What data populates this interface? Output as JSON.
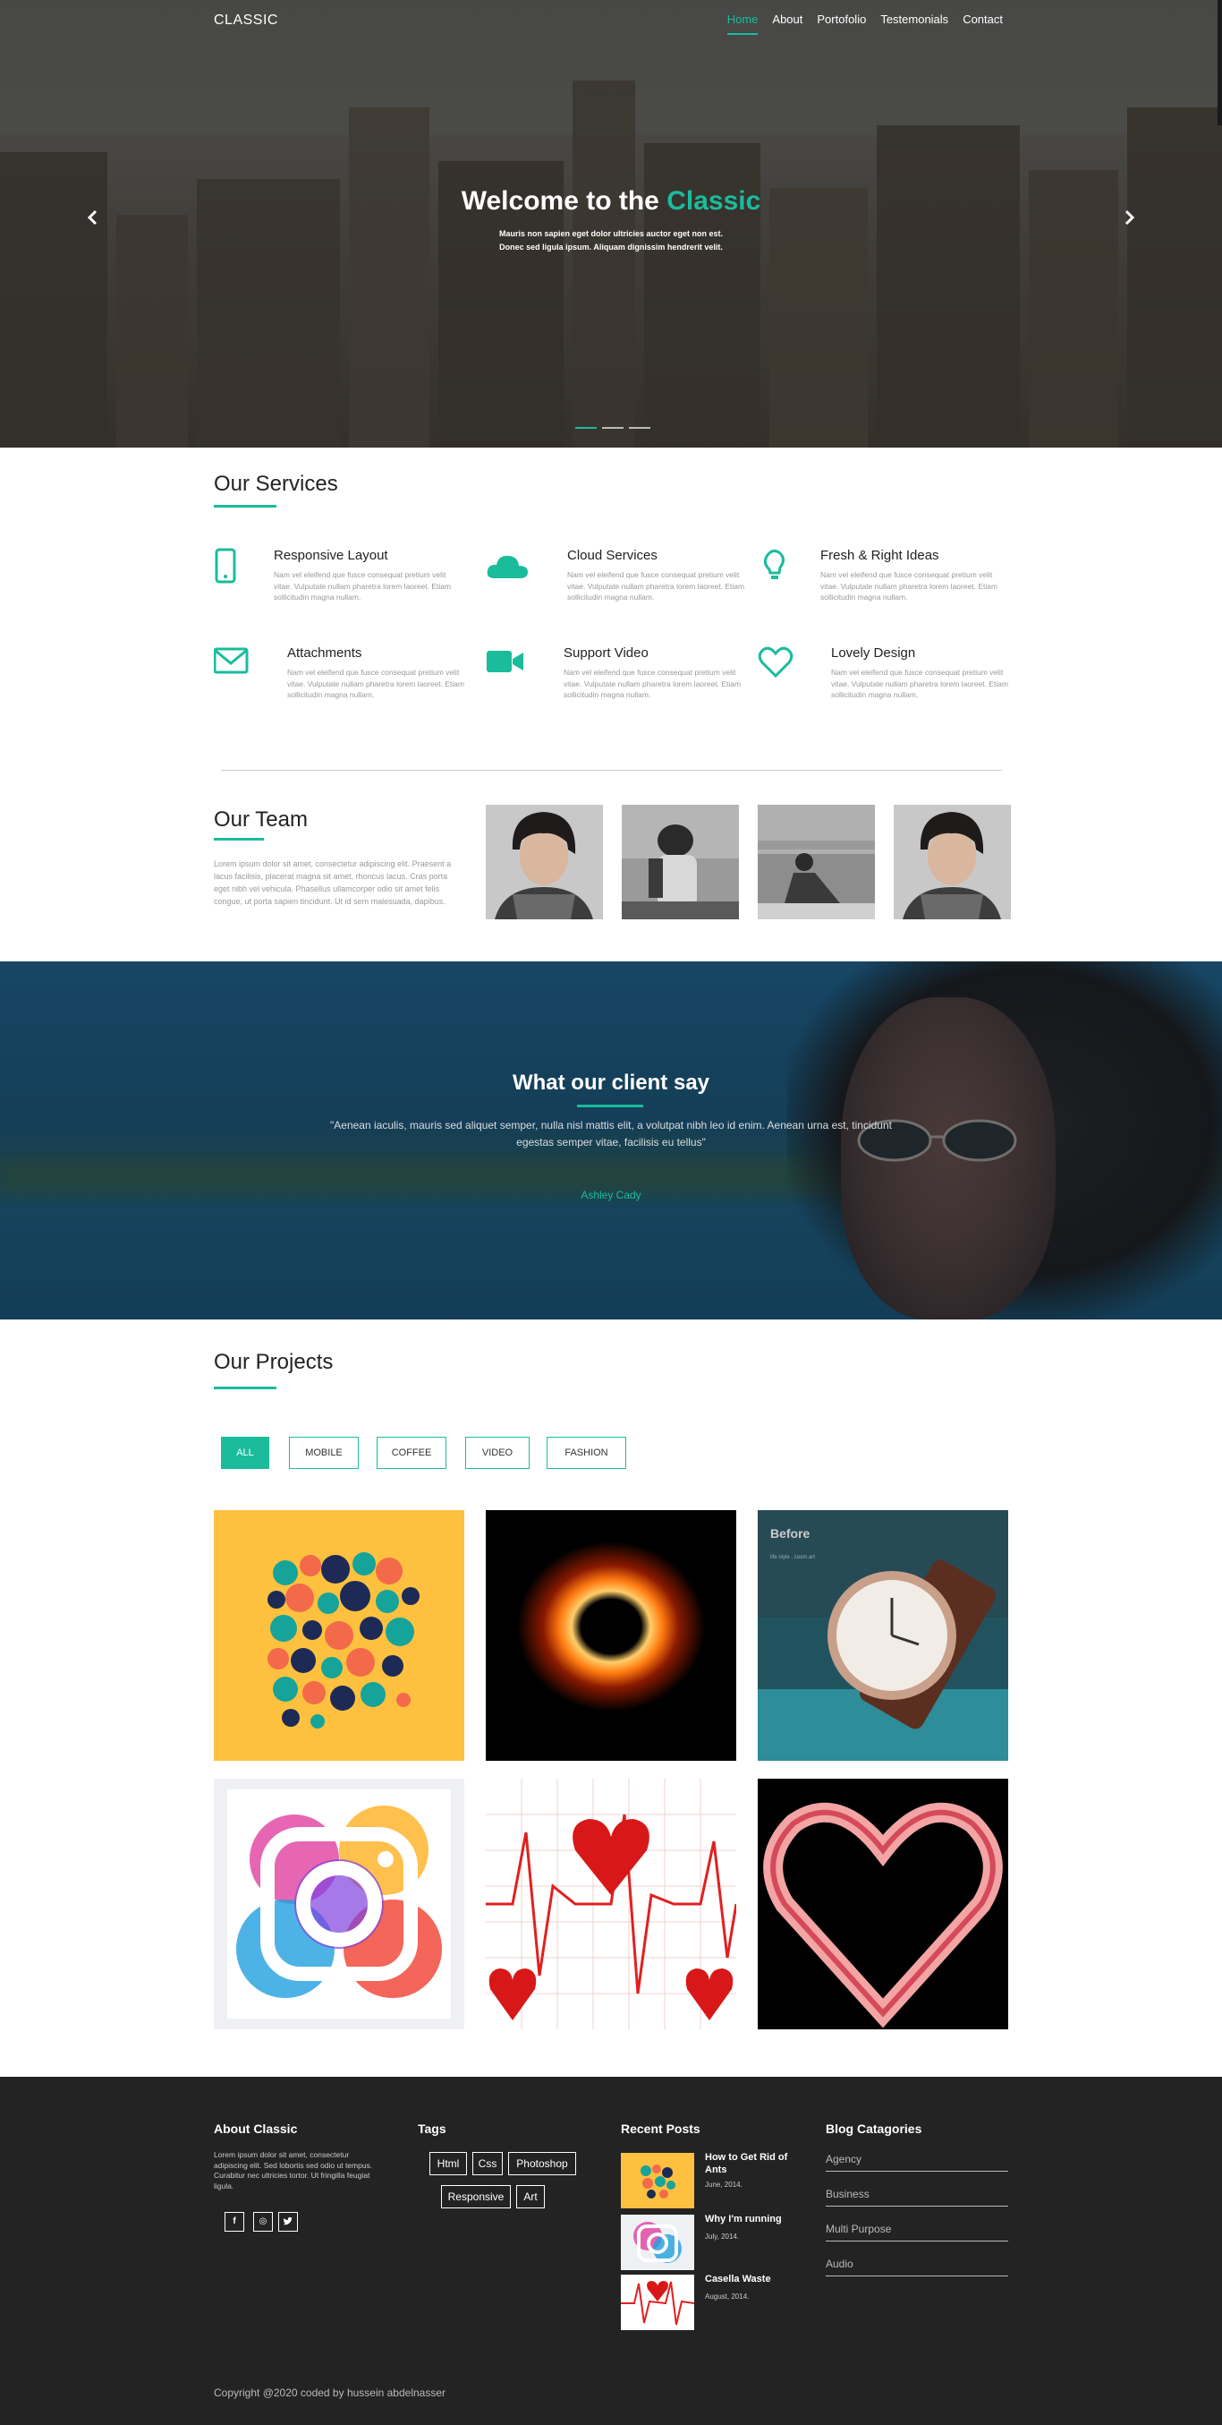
{
  "nav": {
    "logo": "CLASSIC",
    "items": [
      {
        "label": "Home",
        "active": true
      },
      {
        "label": "About"
      },
      {
        "label": "Portofolio"
      },
      {
        "label": "Testemonials"
      },
      {
        "label": "Contact"
      }
    ]
  },
  "hero": {
    "title_prefix": "Welcome to the ",
    "title_accent": "Classic",
    "subtitle_line1": "Mauris non sapien eget dolor ultricies auctor eget non est.",
    "subtitle_line2": "Donec sed ligula ipsum. Aliquam dignissim hendrerit velit.",
    "prev_icon": "chevron-left-icon",
    "next_icon": "chevron-right-icon",
    "slide_indicators": 3,
    "active_slide": 1
  },
  "services": {
    "heading": "Our Services",
    "items": [
      {
        "icon": "phone-icon",
        "title": "Responsive Layout",
        "text": "Nam vel eleifend que fusce consequat pretium velit vitae. Vulputate nullam pharetra lorem laoreet. Etiam sollicitudin magna nullam."
      },
      {
        "icon": "cloud-icon",
        "title": "Cloud Services",
        "text": "Nam vel eleifend que fusce consequat pretium velit vitae. Vulputate nullam pharetra lorem laoreet. Etiam sollicitudin magna nullam."
      },
      {
        "icon": "lightbulb-icon",
        "title": "Fresh & Right Ideas",
        "text": "Nam vel eleifend que fusce consequat pretium velit vitae. Vulputate nullam pharetra lorem laoreet. Etiam sollicitudin magna nullam."
      },
      {
        "icon": "envelope-icon",
        "title": "Attachments",
        "text": "Nam vel eleifend que fusce consequat pretium velit vitae. Vulputate nullam pharetra lorem laoreet. Etiam sollicitudin magna nullam."
      },
      {
        "icon": "video-camera-icon",
        "title": "Support Video",
        "text": "Nam vel eleifend que fusce consequat pretium velit vitae. Vulputate nullam pharetra lorem laoreet. Etiam sollicitudin magna nullam."
      },
      {
        "icon": "heart-icon",
        "title": "Lovely Design",
        "text": "Nam vel eleifend que fusce consequat pretium velit vitae. Vulputate nullam pharetra lorem laoreet. Etiam sollicitudin magna nullam."
      }
    ]
  },
  "team": {
    "heading": "Our Team",
    "text": "Lorem ipsum dolor sit amet, consectetur adipiscing elit. Praesent a lacus facilisis, placerat magna sit amet, rhoncus lacus. Cras porta eget nibh vel vehicula. Phasellus ullamcorper odio sit amet felis congue, ut porta sapien tincidunt. Ut id sem malesuada, dapibus.",
    "members": [
      "member-photo-1",
      "member-photo-2",
      "member-photo-3",
      "member-photo-4"
    ]
  },
  "testimonial": {
    "heading": "What our client say",
    "quote": "\"Aenean iaculis, mauris sed aliquet semper, nulla nisl mattis elit, a volutpat nibh leo id enim. Aenean urna est, tincidunt egestas semper vitae, facilisis eu tellus\"",
    "author": "Ashley Cady"
  },
  "projects": {
    "heading": "Our Projects",
    "filters": [
      "ALL",
      "MOBILE",
      "COFFEE",
      "VIDEO",
      "FASHION"
    ],
    "active_filter": "ALL",
    "watch_before_label": "Before",
    "watch_caption": "life style . zoom art",
    "items": [
      "dots-art",
      "fire-ring",
      "watch",
      "instagram-splash",
      "red-hearts-pattern",
      "pink-heart-outline"
    ]
  },
  "footer": {
    "about_heading": "About Classic",
    "about_text": "Lorem ipsum dolor sit amet, consectetur adipiscing elit. Sed lobortis sed odio ut tempus. Curabitur nec ultricies tortor. Ut fringilla feugiat ligula.",
    "social": [
      {
        "icon": "facebook-icon",
        "glyph": "f"
      },
      {
        "icon": "instagram-icon",
        "glyph": "◎"
      },
      {
        "icon": "twitter-icon",
        "glyph": "🐦"
      }
    ],
    "tags_heading": "Tags",
    "tags": [
      "Html",
      "Css",
      "Photoshop",
      "Responsive",
      "Art"
    ],
    "posts_heading": "Recent Posts",
    "posts": [
      {
        "title": "How to Get Rid of Ants",
        "date": "June, 2014."
      },
      {
        "title": "Why I'm running",
        "date": "July, 2014."
      },
      {
        "title": "Casella Waste",
        "date": "August, 2014."
      }
    ],
    "categories_heading": "Blog Catagories",
    "categories": [
      "Agency",
      "Business",
      "Multi Purpose",
      "Audio"
    ],
    "copyright": "Copyright @2020 coded by hussein abdelnasser"
  },
  "colors": {
    "accent": "#1abc9c",
    "footer_bg": "#232323"
  }
}
